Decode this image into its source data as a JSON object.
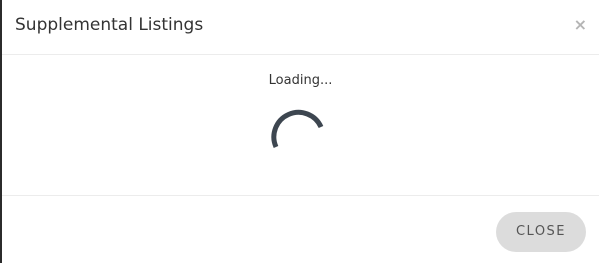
{
  "modal": {
    "title": "Supplemental Listings",
    "close_icon_glyph": "×"
  },
  "body": {
    "loading_text": "Loading..."
  },
  "footer": {
    "close_label": "CLOSE"
  },
  "colors": {
    "spinner": "#3d4650",
    "button_bg": "#dcdcdc",
    "title_text": "#333333"
  },
  "icons": {
    "close": "close-icon",
    "spinner": "loading-spinner-icon"
  }
}
